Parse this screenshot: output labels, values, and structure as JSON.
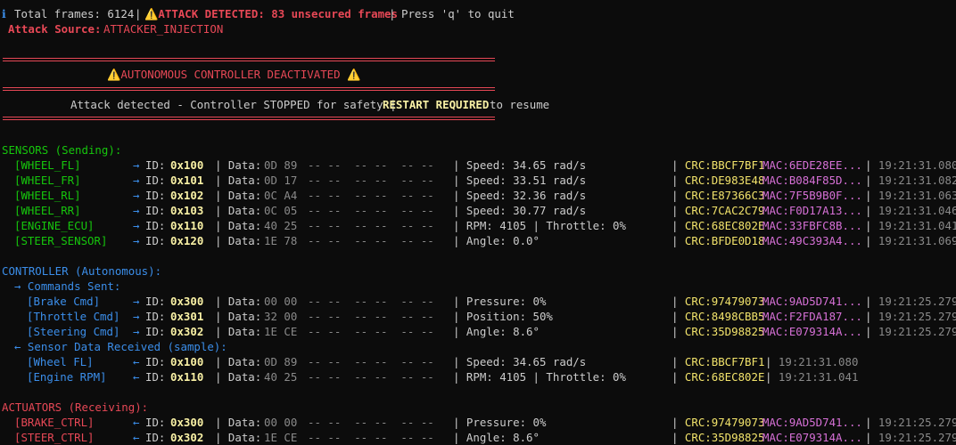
{
  "header": {
    "info_icon": "ℹ",
    "total": "Total frames: 6124",
    "sep": "|",
    "attack_warn": "⚠️ATTACK DETECTED: 83 unsecured frames",
    "sep2": "|",
    "quit": "Press 'q' to quit",
    "source_label": "Attack Source:",
    "source_value": "ATTACKER_INJECTION"
  },
  "banner": {
    "title": "⚠️AUTONOMOUS CONTROLLER DEACTIVATED ⚠️",
    "msg_pre": "Attack detected - Controller STOPPED for safety |",
    "msg_restart": "RESTART REQUIRED",
    "msg_post": "to resume"
  },
  "sensors": {
    "title": "SENSORS (Sending):",
    "rows": [
      {
        "name": "[WHEEL_FL]",
        "arrow": "→",
        "id_label": "ID:",
        "id": "0x100",
        "data_label": "| Data:",
        "b1": "0D 89",
        "rest": "-- --  -- --  -- --",
        "value": "| Speed: 34.65 rad/s",
        "crc": "| CRC:BBCF7BF1",
        "mac": "MAC:6EDE28EE...",
        "time": "| 19:21:31.080"
      },
      {
        "name": "[WHEEL_FR]",
        "arrow": "→",
        "id_label": "ID:",
        "id": "0x101",
        "data_label": "| Data:",
        "b1": "0D 17",
        "rest": "-- --  -- --  -- --",
        "value": "| Speed: 33.51 rad/s",
        "crc": "| CRC:DE983E48",
        "mac": "MAC:B084F85D...",
        "time": "| 19:21:31.082"
      },
      {
        "name": "[WHEEL_RL]",
        "arrow": "→",
        "id_label": "ID:",
        "id": "0x102",
        "data_label": "| Data:",
        "b1": "0C A4",
        "rest": "-- --  -- --  -- --",
        "value": "| Speed: 32.36 rad/s",
        "crc": "| CRC:E87366C3",
        "mac": "MAC:7F5B9B0F...",
        "time": "| 19:21:31.063"
      },
      {
        "name": "[WHEEL_RR]",
        "arrow": "→",
        "id_label": "ID:",
        "id": "0x103",
        "data_label": "| Data:",
        "b1": "0C 05",
        "rest": "-- --  -- --  -- --",
        "value": "| Speed: 30.77 rad/s",
        "crc": "| CRC:7CAC2C79",
        "mac": "MAC:F0D17A13...",
        "time": "| 19:21:31.046"
      },
      {
        "name": "[ENGINE_ECU]",
        "arrow": "→",
        "id_label": "ID:",
        "id": "0x110",
        "data_label": "| Data:",
        "b1": "40 25",
        "rest": "-- --  -- --  -- --",
        "value": "| RPM: 4105 | Throttle: 0%",
        "crc": "| CRC:68EC802E",
        "mac": "MAC:33FBFC8B...",
        "time": "| 19:21:31.041"
      },
      {
        "name": "[STEER_SENSOR]",
        "arrow": "→",
        "id_label": "ID:",
        "id": "0x120",
        "data_label": "| Data:",
        "b1": "1E 78",
        "rest": "-- --  -- --  -- --",
        "value": "| Angle: 0.0°",
        "crc": "| CRC:BFDE0D18",
        "mac": "MAC:49C393A4...",
        "time": "| 19:21:31.069"
      }
    ]
  },
  "controller": {
    "title": "CONTROLLER (Autonomous):",
    "cmd_header": "→ Commands Sent:",
    "cmds": [
      {
        "name": "[Brake Cmd]",
        "arrow": "→",
        "id_label": "ID:",
        "id": "0x300",
        "data_label": "| Data:",
        "b1": "00 00",
        "rest": "-- --  -- --  -- --",
        "value": "| Pressure: 0%",
        "crc": "| CRC:97479073",
        "mac": "MAC:9AD5D741...",
        "time": "| 19:21:25.279"
      },
      {
        "name": "[Throttle Cmd]",
        "arrow": "→",
        "id_label": "ID:",
        "id": "0x301",
        "data_label": "| Data:",
        "b1": "32 00",
        "rest": "-- --  -- --  -- --",
        "value": "| Position: 50%",
        "crc": "| CRC:8498CBB5",
        "mac": "MAC:F2FDA187...",
        "time": "| 19:21:25.279"
      },
      {
        "name": "[Steering Cmd]",
        "arrow": "→",
        "id_label": "ID:",
        "id": "0x302",
        "data_label": "| Data:",
        "b1": "1E CE",
        "rest": "-- --  -- --  -- --",
        "value": "| Angle: 8.6°",
        "crc": "| CRC:35D98825",
        "mac": "MAC:E079314A...",
        "time": "| 19:21:25.279"
      }
    ],
    "recv_header": "← Sensor Data Received (sample):",
    "recv": [
      {
        "name": "[Wheel FL]",
        "arrow": "←",
        "id_label": "ID:",
        "id": "0x100",
        "data_label": "| Data:",
        "b1": "0D 89",
        "rest": "-- --  -- --  -- --",
        "value": "| Speed: 34.65 rad/s",
        "crc": "| CRC:BBCF7BF1",
        "time": "| 19:21:31.080"
      },
      {
        "name": "[Engine RPM]",
        "arrow": "←",
        "id_label": "ID:",
        "id": "0x110",
        "data_label": "| Data:",
        "b1": "40 25",
        "rest": "-- --  -- --  -- --",
        "value": "| RPM: 4105 | Throttle: 0%",
        "crc": "| CRC:68EC802E",
        "time": "| 19:21:31.041"
      }
    ]
  },
  "actuators": {
    "title": "ACTUATORS (Receiving):",
    "rows": [
      {
        "name": "[BRAKE_CTRL]",
        "arrow": "←",
        "id_label": "ID:",
        "id": "0x300",
        "data_label": "| Data:",
        "b1": "00 00",
        "rest": "-- --  -- --  -- --",
        "value": "| Pressure: 0%",
        "crc": "| CRC:97479073",
        "mac": "MAC:9AD5D741...",
        "time": "| 19:21:25.279"
      },
      {
        "name": "[STEER_CTRL]",
        "arrow": "←",
        "id_label": "ID:",
        "id": "0x302",
        "data_label": "| Data:",
        "b1": "1E CE",
        "rest": "-- --  -- --  -- --",
        "value": "| Angle: 8.6°",
        "crc": "| CRC:35D98825",
        "mac": "MAC:E079314A...",
        "time": "| 19:21:25.279"
      }
    ]
  },
  "colors": {
    "background": "#0c0c0c",
    "sensor": "#16c60c",
    "controller": "#3b8eea",
    "alert": "#e74856",
    "id_value": "#f9f1a5",
    "mac": "#d670d6"
  }
}
